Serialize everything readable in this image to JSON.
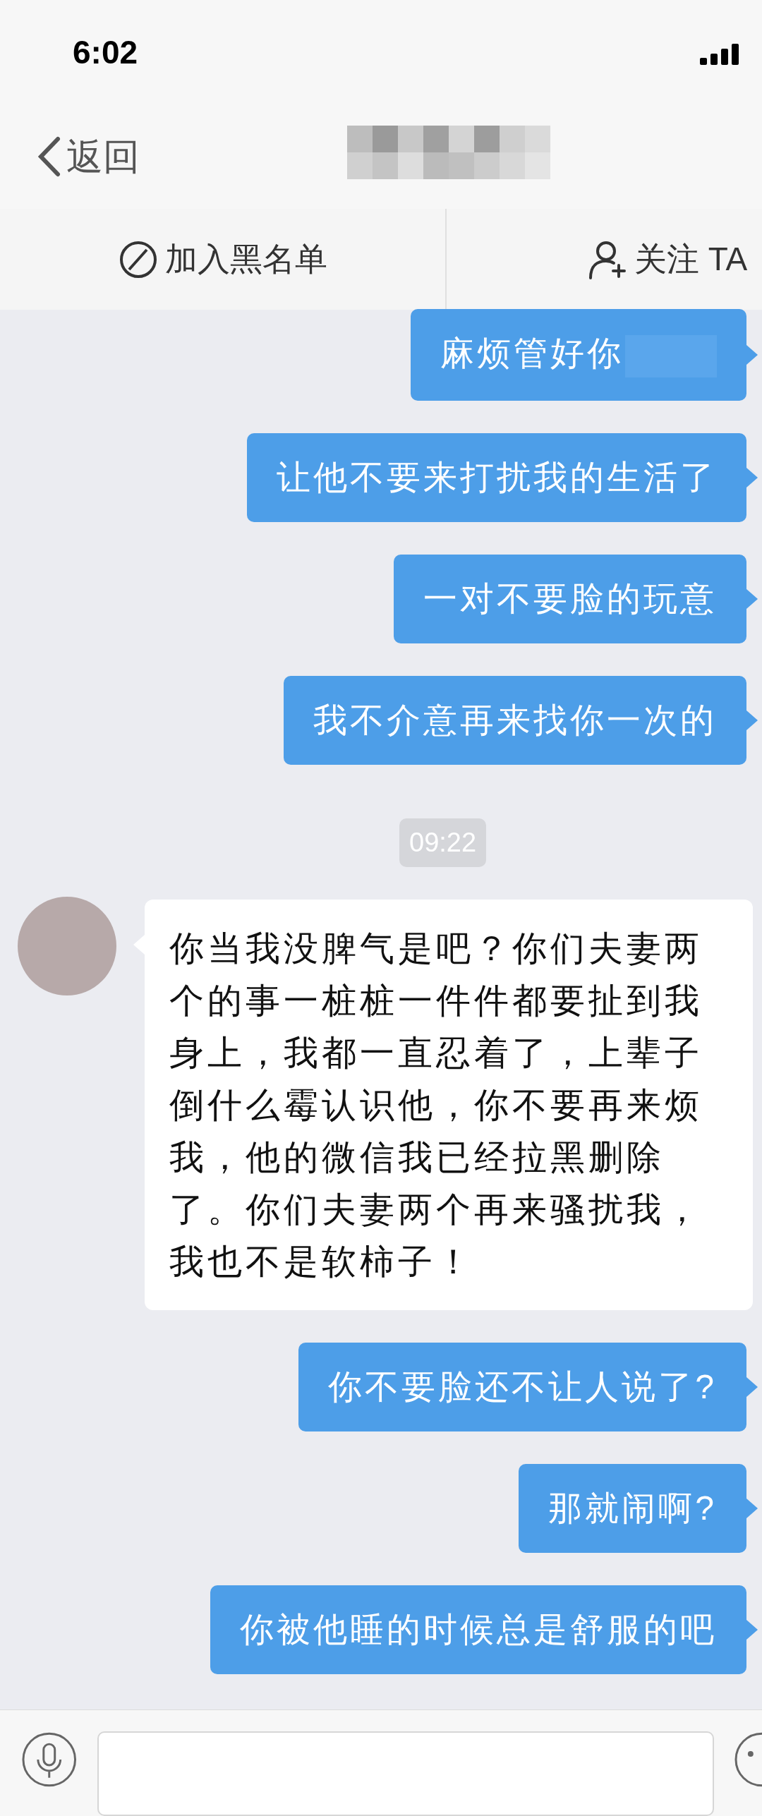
{
  "status_bar": {
    "time": "6:02"
  },
  "nav": {
    "back": "返回"
  },
  "actions": [
    {
      "kind": "block",
      "label": "加入黑名单"
    },
    {
      "kind": "follow",
      "label": "关注 TA"
    }
  ],
  "messages": [
    {
      "kind": "outgoing",
      "text": "麻烦管好你",
      "redacted": true
    },
    {
      "kind": "outgoing",
      "text": "让他不要来打扰我的生活了"
    },
    {
      "kind": "outgoing",
      "text": "一对不要脸的玩意"
    },
    {
      "kind": "outgoing",
      "text": "我不介意再来找你一次的"
    },
    {
      "kind": "timestamp",
      "text": "09:22"
    },
    {
      "kind": "incoming",
      "text": "你当我没脾气是吧？你们夫妻两个的事一桩桩一件件都要扯到我身上，我都一直忍着了，上辈子倒什么霉认识他，你不要再来烦我，他的微信我已经拉黑删除了。你们夫妻两个再来骚扰我，我也不是软柿子！"
    },
    {
      "kind": "outgoing",
      "text": "你不要脸还不让人说了?"
    },
    {
      "kind": "outgoing",
      "text": "那就闹啊?"
    },
    {
      "kind": "outgoing",
      "text": "你被他睡的时候总是舒服的吧"
    }
  ]
}
